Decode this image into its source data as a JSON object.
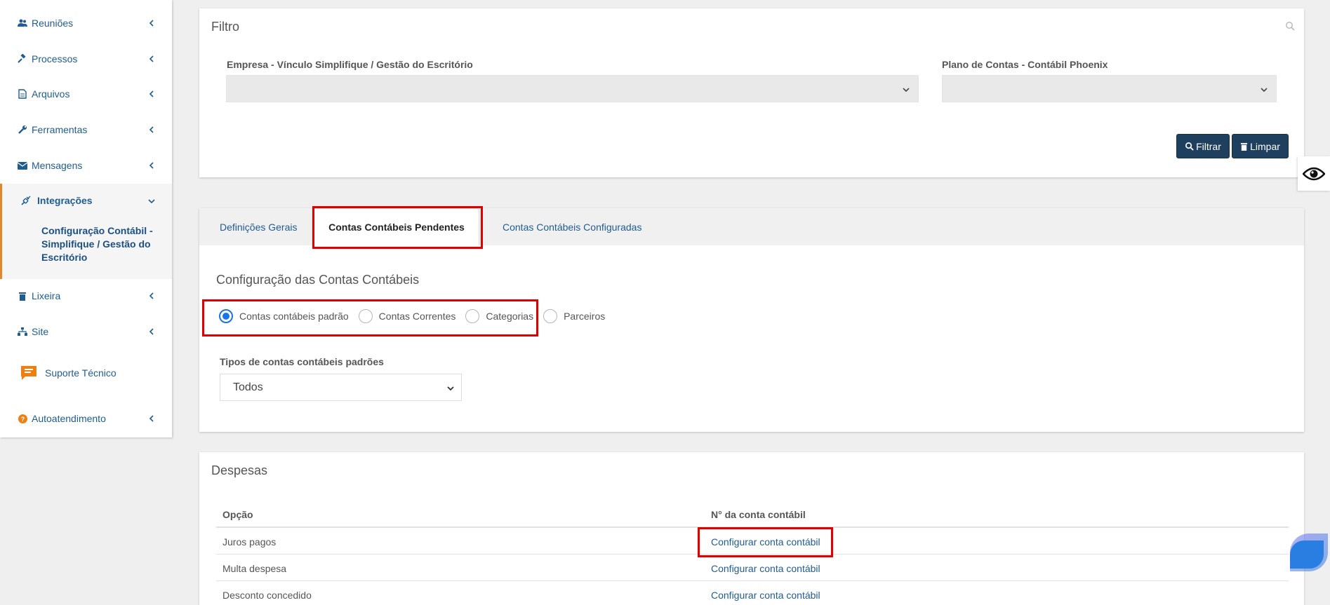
{
  "sidebar": {
    "items": [
      {
        "label": "Reuniões",
        "icon": "users-icon"
      },
      {
        "label": "Processos",
        "icon": "gavel-icon"
      },
      {
        "label": "Arquivos",
        "icon": "file-icon"
      },
      {
        "label": "Ferramentas",
        "icon": "wrench-icon"
      },
      {
        "label": "Mensagens",
        "icon": "envelope-icon"
      }
    ],
    "integracoes": {
      "label": "Integrações",
      "icon": "plug-icon",
      "sub_item": "Configuração Contábil - Simplifique / Gestão do Escritório"
    },
    "items_after": [
      {
        "label": "Lixeira",
        "icon": "trash-icon"
      },
      {
        "label": "Site",
        "icon": "sitemap-icon"
      }
    ],
    "support": {
      "label": "Suporte Técnico",
      "icon": "chat-bubble-icon"
    },
    "autoatendimento": {
      "label": "Autoatendimento",
      "icon": "question-circle-icon"
    }
  },
  "filter": {
    "title": "Filtro",
    "empresa_label": "Empresa - Vínculo Simplifique / Gestão do Escritório",
    "empresa_value": "",
    "plano_label": "Plano de Contas - Contábil Phoenix",
    "plano_value": "",
    "filtrar_label": "Filtrar",
    "limpar_label": "Limpar"
  },
  "tabs": [
    {
      "label": "Definições Gerais",
      "active": false
    },
    {
      "label": "Contas Contábeis Pendentes",
      "active": true
    },
    {
      "label": "Contas Contábeis Configuradas",
      "active": false
    }
  ],
  "config": {
    "title": "Configuração das Contas Contábeis",
    "radios": [
      {
        "label": "Contas contábeis padrão",
        "checked": true
      },
      {
        "label": "Contas Correntes",
        "checked": false
      },
      {
        "label": "Categorias",
        "checked": false
      },
      {
        "label": "Parceiros",
        "checked": false
      }
    ],
    "type_label": "Tipos de contas contábeis padrões",
    "type_value": "Todos"
  },
  "despesas": {
    "title": "Despesas",
    "columns": [
      "Opção",
      "N° da conta contábil"
    ],
    "rows": [
      {
        "option": "Juros pagos",
        "action": "Configurar conta contábil"
      },
      {
        "option": "Multa despesa",
        "action": "Configurar conta contábil"
      },
      {
        "option": "Desconto concedido",
        "action": "Configurar conta contábil"
      }
    ]
  },
  "colors": {
    "accent_link": "#1f5c91",
    "button_bg": "#1f3f5e",
    "highlight_red": "#e00000",
    "active_marker": "#e0872c",
    "radio_blue": "#1a73e8"
  }
}
